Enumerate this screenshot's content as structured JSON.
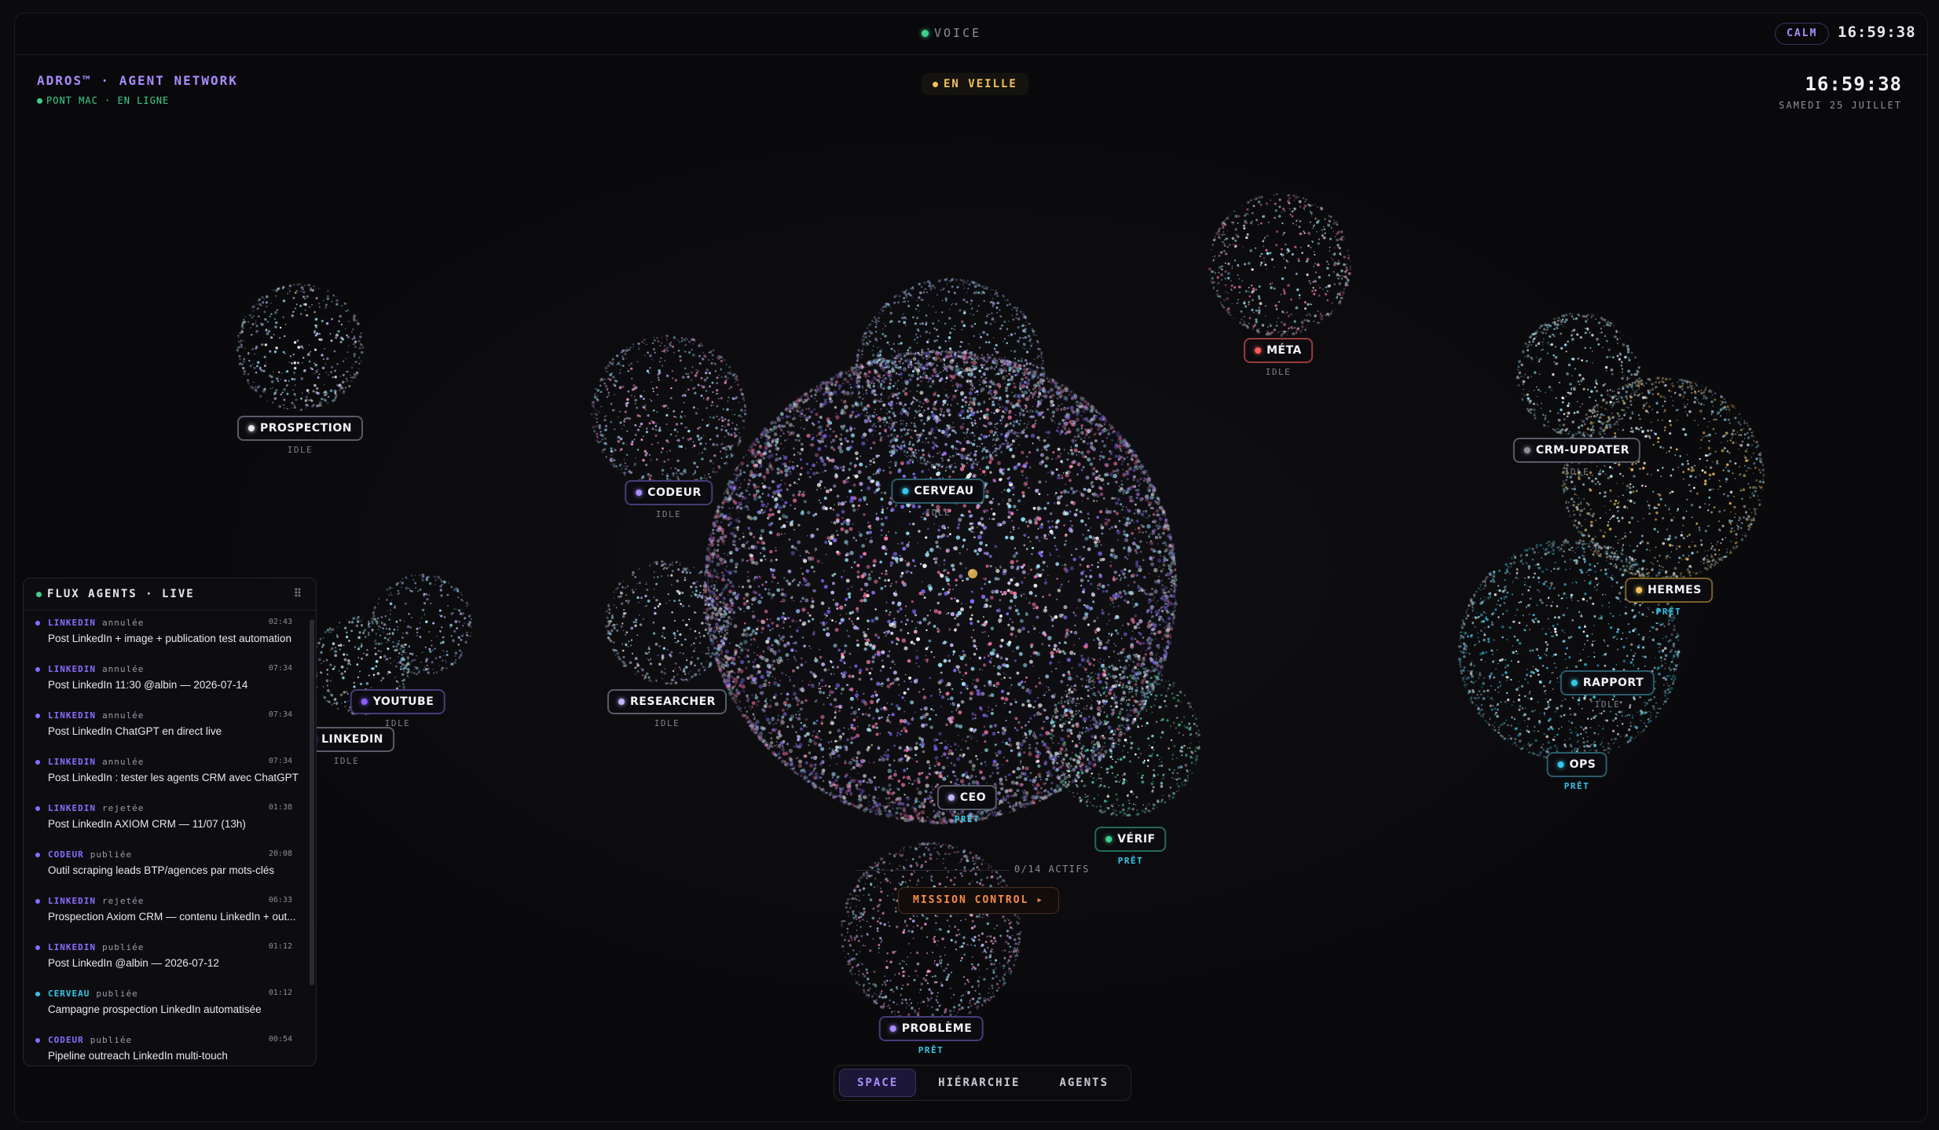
{
  "colors": {
    "accent": "#a98cff",
    "online": "#3ecf8e",
    "idle_amber": "#f1c25b",
    "ready": "#35c6e8",
    "mission": "#ff8a4c",
    "meta_red": "#ff5a5a"
  },
  "topbar": {
    "voice_label": "VOICE",
    "mode_badge": "CALM",
    "clock": "16:59:38"
  },
  "header": {
    "brand": "ADROS™ · AGENT NETWORK",
    "status": "PONT MAC · EN LIGNE",
    "state_badge": "EN VEILLE",
    "clock": "16:59:38",
    "date": "SAMEDI 25 JUILLET"
  },
  "nodes": [
    {
      "id": "prospection",
      "label": "PROSPECTION",
      "state": "IDLE",
      "dot": "#e8e8ee"
    },
    {
      "id": "codeur",
      "label": "CODEUR",
      "state": "IDLE",
      "dot": "#a98cff"
    },
    {
      "id": "cerveau",
      "label": "CERVEAU",
      "state": "IDLE",
      "dot": "#35c6e8"
    },
    {
      "id": "meta",
      "label": "MÉTA",
      "state": "IDLE",
      "dot": "#ff5a5a"
    },
    {
      "id": "crm",
      "label": "CRM-UPDATER",
      "state": "IDLE",
      "dot": "#8d909a"
    },
    {
      "id": "hermes",
      "label": "HERMES",
      "state": "PRÊT",
      "dot": "#f1c25b"
    },
    {
      "id": "rapport",
      "label": "RAPPORT",
      "state": "IDLE",
      "dot": "#35c6e8"
    },
    {
      "id": "ops",
      "label": "OPS",
      "state": "PRÊT",
      "dot": "#35c6e8"
    },
    {
      "id": "youtube",
      "label": "YOUTUBE",
      "state": "IDLE",
      "dot": "#8a5cff"
    },
    {
      "id": "linkedin",
      "label": "LINKEDIN",
      "state": "IDLE",
      "dot": "#a98cff"
    },
    {
      "id": "researcher",
      "label": "RESEARCHER",
      "state": "IDLE",
      "dot": "#c3b4ff"
    },
    {
      "id": "ceo",
      "label": "CEO",
      "state": "PRÊT",
      "dot": "#c3b4ff"
    },
    {
      "id": "verif",
      "label": "VÉRIF",
      "state": "PRÊT",
      "dot": "#3ecf8e"
    },
    {
      "id": "probleme",
      "label": "PROBLÈME",
      "state": "PRÊT",
      "dot": "#a98cff"
    }
  ],
  "feed": {
    "title": "FLUX AGENTS · LIVE",
    "items": [
      {
        "agent": "LINKEDIN",
        "status": "annulée",
        "time": "02:43",
        "title": "Post LinkedIn + image + publication test automation",
        "color": "#8a6cff"
      },
      {
        "agent": "LINKEDIN",
        "status": "annulée",
        "time": "07:34",
        "title": "Post LinkedIn 11:30 @albin — 2026-07-14",
        "color": "#8a6cff"
      },
      {
        "agent": "LINKEDIN",
        "status": "annulée",
        "time": "07:34",
        "title": "Post LinkedIn ChatGPT en direct live",
        "color": "#8a6cff"
      },
      {
        "agent": "LINKEDIN",
        "status": "annulée",
        "time": "07:34",
        "title": "Post LinkedIn : tester les agents CRM avec ChatGPT",
        "color": "#8a6cff"
      },
      {
        "agent": "LINKEDIN",
        "status": "rejetée",
        "time": "01:38",
        "title": "Post LinkedIn AXIOM CRM — 11/07 (13h)",
        "color": "#8a6cff"
      },
      {
        "agent": "CODEUR",
        "status": "publiée",
        "time": "20:08",
        "title": "Outil scraping leads BTP/agences par mots-clés",
        "color": "#8a6cff"
      },
      {
        "agent": "LINKEDIN",
        "status": "rejetée",
        "time": "06:33",
        "title": "Prospection Axiom CRM — contenu LinkedIn + out...",
        "color": "#8a6cff"
      },
      {
        "agent": "LINKEDIN",
        "status": "publiée",
        "time": "01:12",
        "title": "Post LinkedIn @albin — 2026-07-12",
        "color": "#8a6cff"
      },
      {
        "agent": "CERVEAU",
        "status": "publiée",
        "time": "01:12",
        "title": "Campagne prospection LinkedIn automatisée",
        "color": "#35c6e8"
      },
      {
        "agent": "CODEUR",
        "status": "publiée",
        "time": "00:54",
        "title": "Pipeline outreach LinkedIn multi-touch",
        "color": "#8a6cff"
      }
    ]
  },
  "footer": {
    "actifs": "0/14 ACTIFS",
    "mission": "MISSION CONTROL ▸",
    "tabs": [
      "SPACE",
      "HIÉRARCHIE",
      "AGENTS"
    ]
  }
}
